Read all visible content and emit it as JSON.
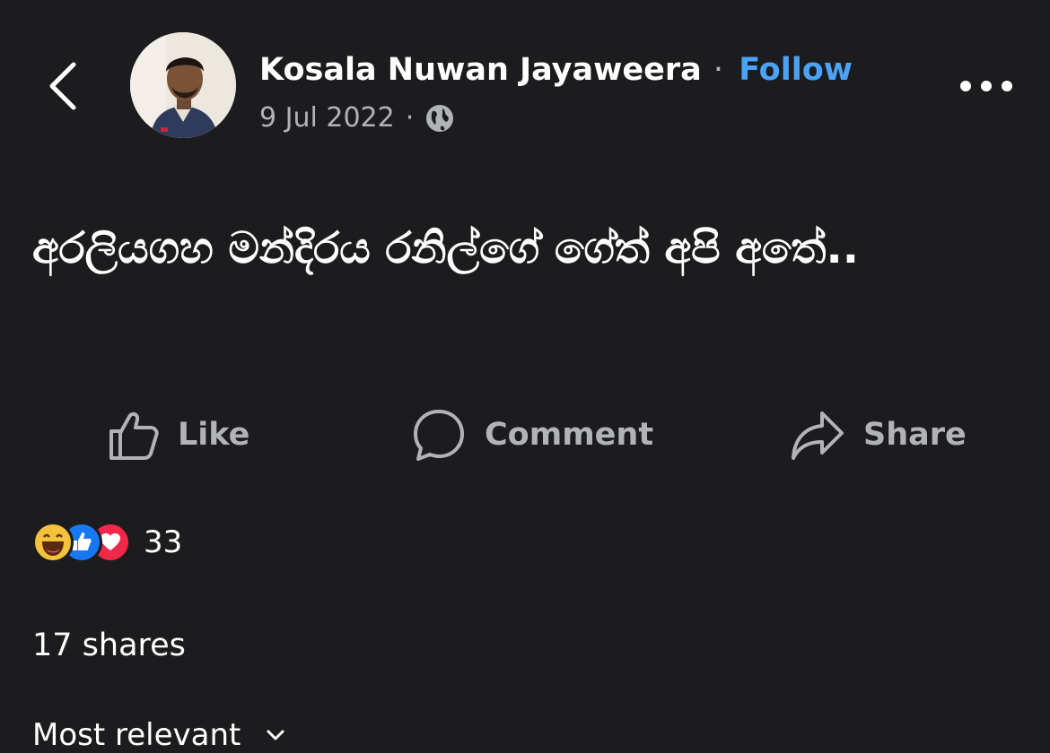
{
  "header": {
    "author_name": "Kosala Nuwan Jayaweera",
    "separator": "·",
    "follow_label": "Follow",
    "date": "9 Jul 2022",
    "meta_separator": "·",
    "privacy_icon": "globe-icon",
    "back_icon": "chevron-left-icon",
    "more_icon": "more-horizontal-icon"
  },
  "post": {
    "text": "අරලියගහ මන්දිරය රනිල්ගේ ගේත් අපි අතේ.."
  },
  "actions": {
    "like_label": "Like",
    "comment_label": "Comment",
    "share_label": "Share"
  },
  "reactions": {
    "types": [
      "haha",
      "like",
      "love"
    ],
    "count": "33"
  },
  "shares": "17 shares",
  "sort": {
    "label": "Most relevant",
    "icon": "chevron-down-icon"
  },
  "colors": {
    "background": "#1c1c1e",
    "accent": "#4aa3f5",
    "muted": "#b0b3b8"
  }
}
